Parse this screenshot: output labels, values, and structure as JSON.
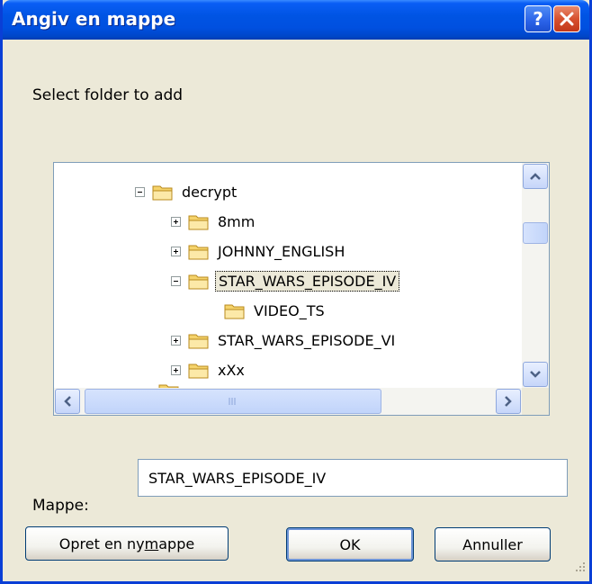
{
  "window": {
    "title": "Angiv en mappe",
    "help_label": "?"
  },
  "prompt": "Select folder to add",
  "tree": {
    "nodes": [
      {
        "label": "decrypt",
        "expander": "minus",
        "selected": false
      },
      {
        "label": "8mm",
        "expander": "plus",
        "selected": false
      },
      {
        "label": "JOHNNY_ENGLISH",
        "expander": "plus",
        "selected": false
      },
      {
        "label": "STAR_WARS_EPISODE_IV",
        "expander": "minus",
        "selected": true
      },
      {
        "label": "VIDEO_TS",
        "expander": "none",
        "selected": false
      },
      {
        "label": "STAR_WARS_EPISODE_VI",
        "expander": "plus",
        "selected": false
      },
      {
        "label": "xXx",
        "expander": "plus",
        "selected": false
      }
    ]
  },
  "folder_field": {
    "label": "Mappe:",
    "value": "STAR_WARS_EPISODE_IV"
  },
  "buttons": {
    "new_folder": "Opret en ny mappe",
    "ok": "OK",
    "cancel": "Annuller"
  },
  "icons": {
    "folder": "folder-icon",
    "help": "help-icon",
    "close": "close-icon",
    "scroll_up": "arrow-up-icon",
    "scroll_down": "arrow-down-icon",
    "scroll_left": "arrow-left-icon",
    "scroll_right": "arrow-right-icon"
  },
  "colors": {
    "titlebar": "#0054e3",
    "dialog_bg": "#ece9d8",
    "folder": "#f5d36b"
  }
}
